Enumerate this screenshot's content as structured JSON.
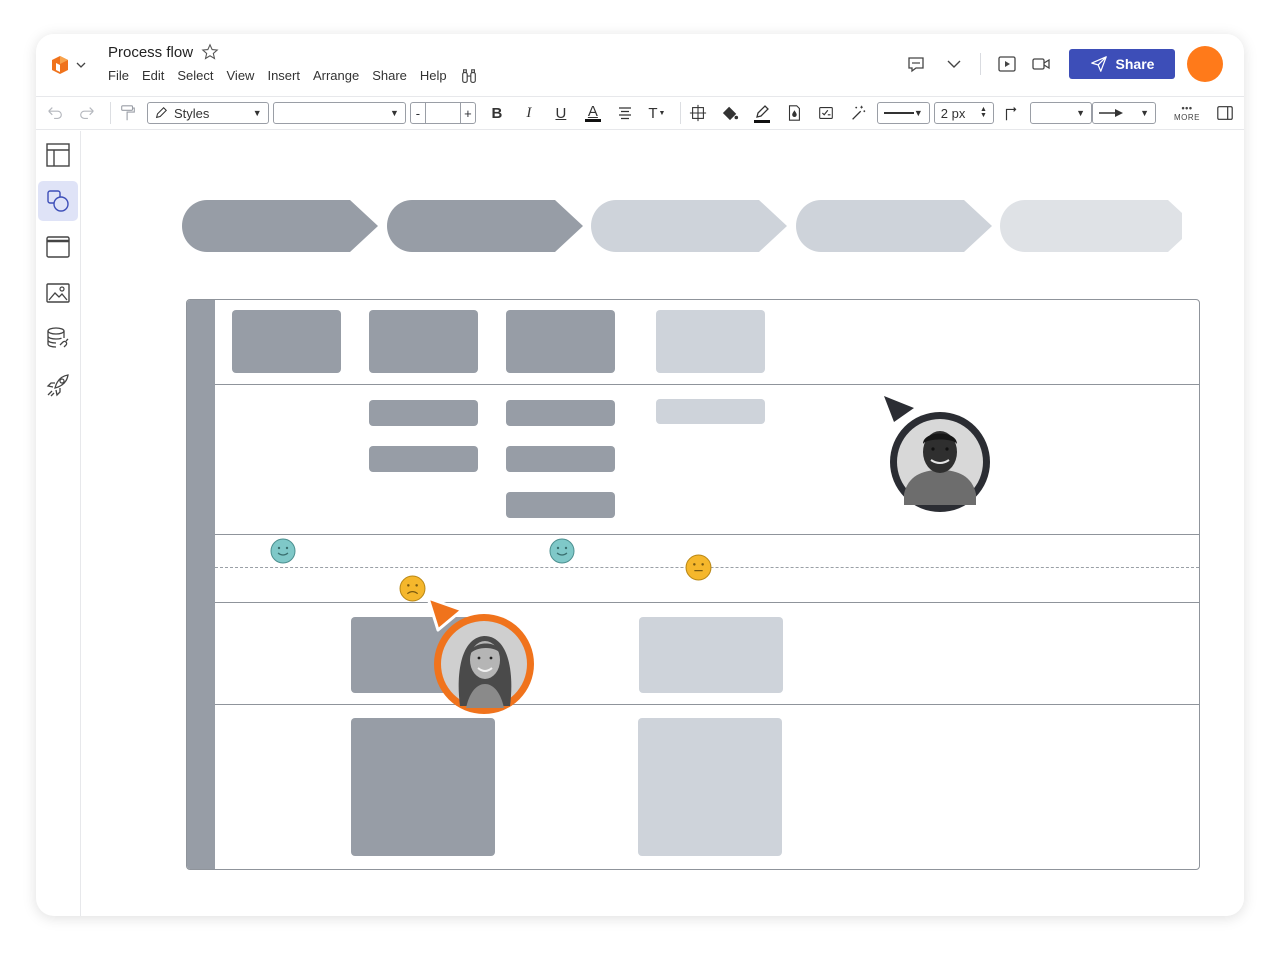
{
  "app": {
    "title": "Process flow",
    "logo_icon": "lucid-logo-icon",
    "favorite_icon": "star-outline-icon"
  },
  "menu": {
    "items": [
      "File",
      "Edit",
      "Select",
      "View",
      "Insert",
      "Arrange",
      "Share",
      "Help"
    ],
    "feature_find_icon": "binoculars-icon"
  },
  "header_right": {
    "comment_icon": "quote-comment-icon",
    "collapse_icon": "chevron-down-icon",
    "present_icon": "present-play-icon",
    "video_icon": "video-camera-icon",
    "share_label": "Share",
    "share_icon": "paper-plane-icon",
    "user_avatar_color": "#ff7a1a",
    "share_color": "#3d4eb8"
  },
  "toolbar": {
    "styles_label": "Styles",
    "font_value": "",
    "font_size_minus": "-",
    "font_size_plus": "+",
    "bold": "B",
    "italic": "I",
    "underline": "U",
    "text_color": "A",
    "text_options": "T",
    "line_width": "2 px",
    "more_label": "MORE",
    "more_dots": "•••"
  },
  "sidebar": {
    "items": [
      {
        "icon": "layout-panel-icon"
      },
      {
        "icon": "shapes-icon",
        "active": true
      },
      {
        "icon": "frame-icon"
      },
      {
        "icon": "image-icon"
      },
      {
        "icon": "data-link-icon"
      },
      {
        "icon": "rocket-icon"
      }
    ]
  },
  "diagram": {
    "colors": {
      "dark": "#979da6",
      "light": "#ced3da",
      "lighter": "#dfe2e6",
      "happy_face": "#7fc8c8",
      "neutral_face": "#f5b72c",
      "sad_face": "#f5b72c"
    },
    "collaborators": [
      {
        "name": "collaborator-man",
        "ring_color": "#2b2d33"
      },
      {
        "name": "collaborator-woman",
        "ring_color": "#f0731c"
      }
    ]
  }
}
